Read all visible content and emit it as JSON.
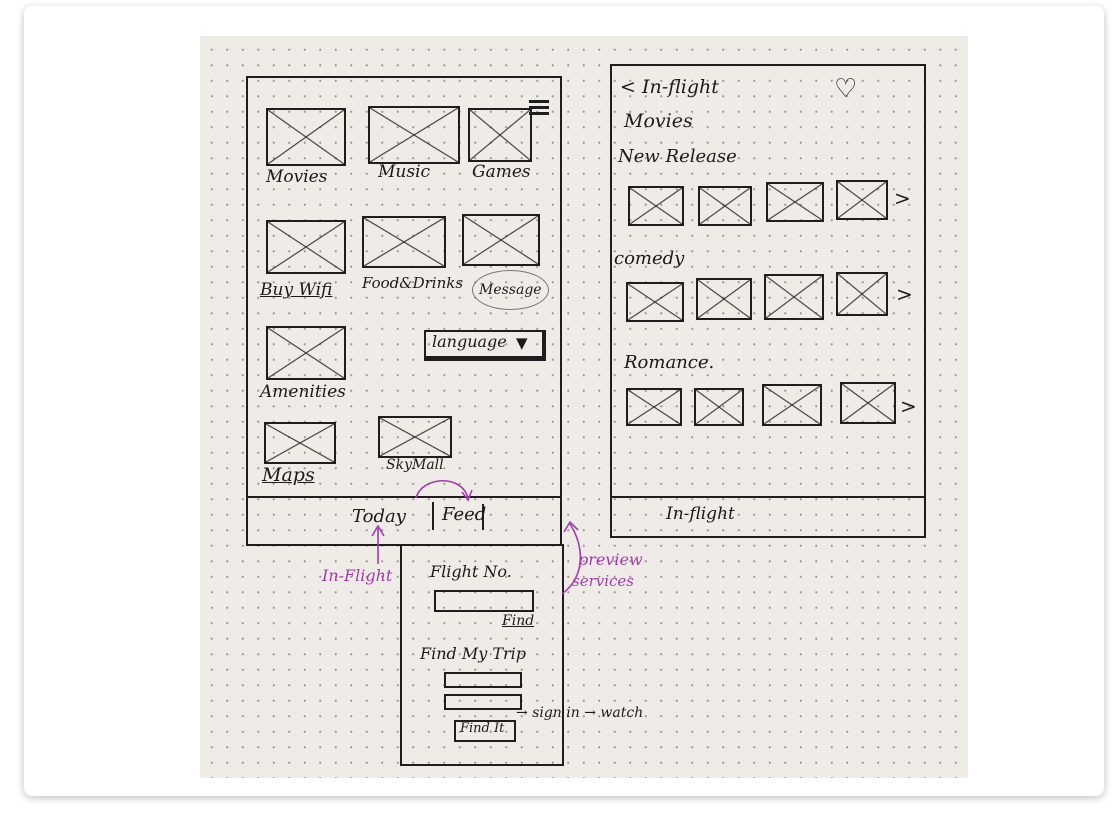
{
  "home": {
    "tiles": [
      "Movies",
      "Music",
      "Games",
      "Buy Wifi",
      "Food&Drinks",
      "Message",
      "Amenities",
      "Maps",
      "SkyMall"
    ],
    "language_dropdown": "language",
    "tabs": [
      "Today",
      "Feed"
    ]
  },
  "inflight": {
    "back_title": "< In-flight",
    "section": "Movies",
    "rows": [
      {
        "label": "New Release"
      },
      {
        "label": "comedy"
      },
      {
        "label": "Romance."
      }
    ],
    "more_arrow": ">",
    "bottom_tab": "In-flight"
  },
  "flight": {
    "flight_no_label": "Flight No.",
    "find_button": "Find",
    "find_trip_label": "Find My Trip",
    "find_it_button": "Find It",
    "flow_note": "→ sign in → watch"
  },
  "annotations": {
    "in_flight": "In-Flight",
    "preview_1": "preview",
    "preview_2": "services"
  },
  "colors": {
    "ink": "#1b1b1b",
    "annotation": "#a43ab0",
    "paper": "#efece7"
  }
}
